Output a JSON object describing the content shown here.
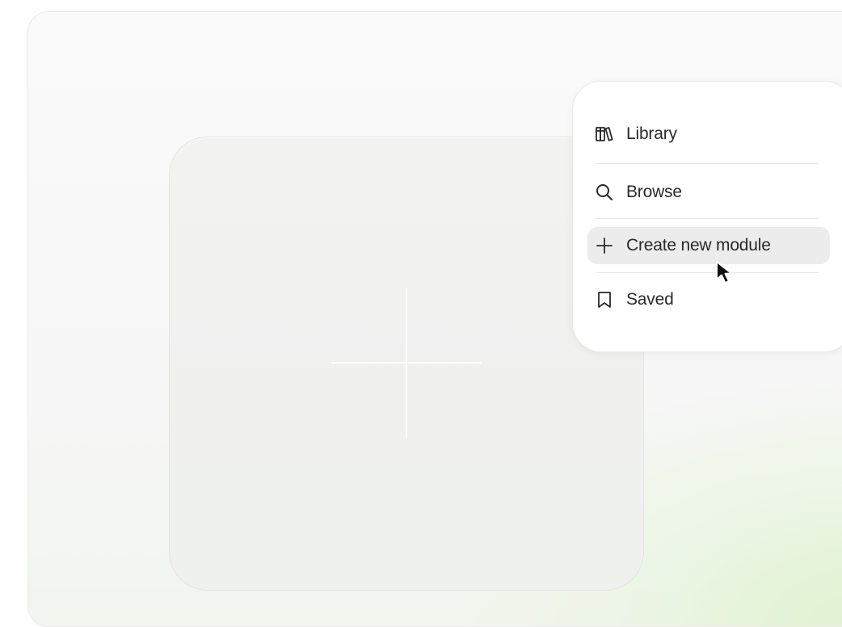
{
  "menu": {
    "items": [
      {
        "label": "Library",
        "icon": "library-icon",
        "active": false
      },
      {
        "label": "Browse",
        "icon": "search-icon",
        "active": false
      },
      {
        "label": "Create new module",
        "icon": "plus-icon",
        "active": true
      },
      {
        "label": "Saved",
        "icon": "bookmark-icon",
        "active": false
      }
    ]
  },
  "add_tile": {
    "icon": "plus-icon"
  },
  "colors": {
    "menu_bg": "#ffffff",
    "active_item_bg": "#ececec",
    "text": "#2a2a2a",
    "accent_gradient": "#e0f2cf"
  }
}
